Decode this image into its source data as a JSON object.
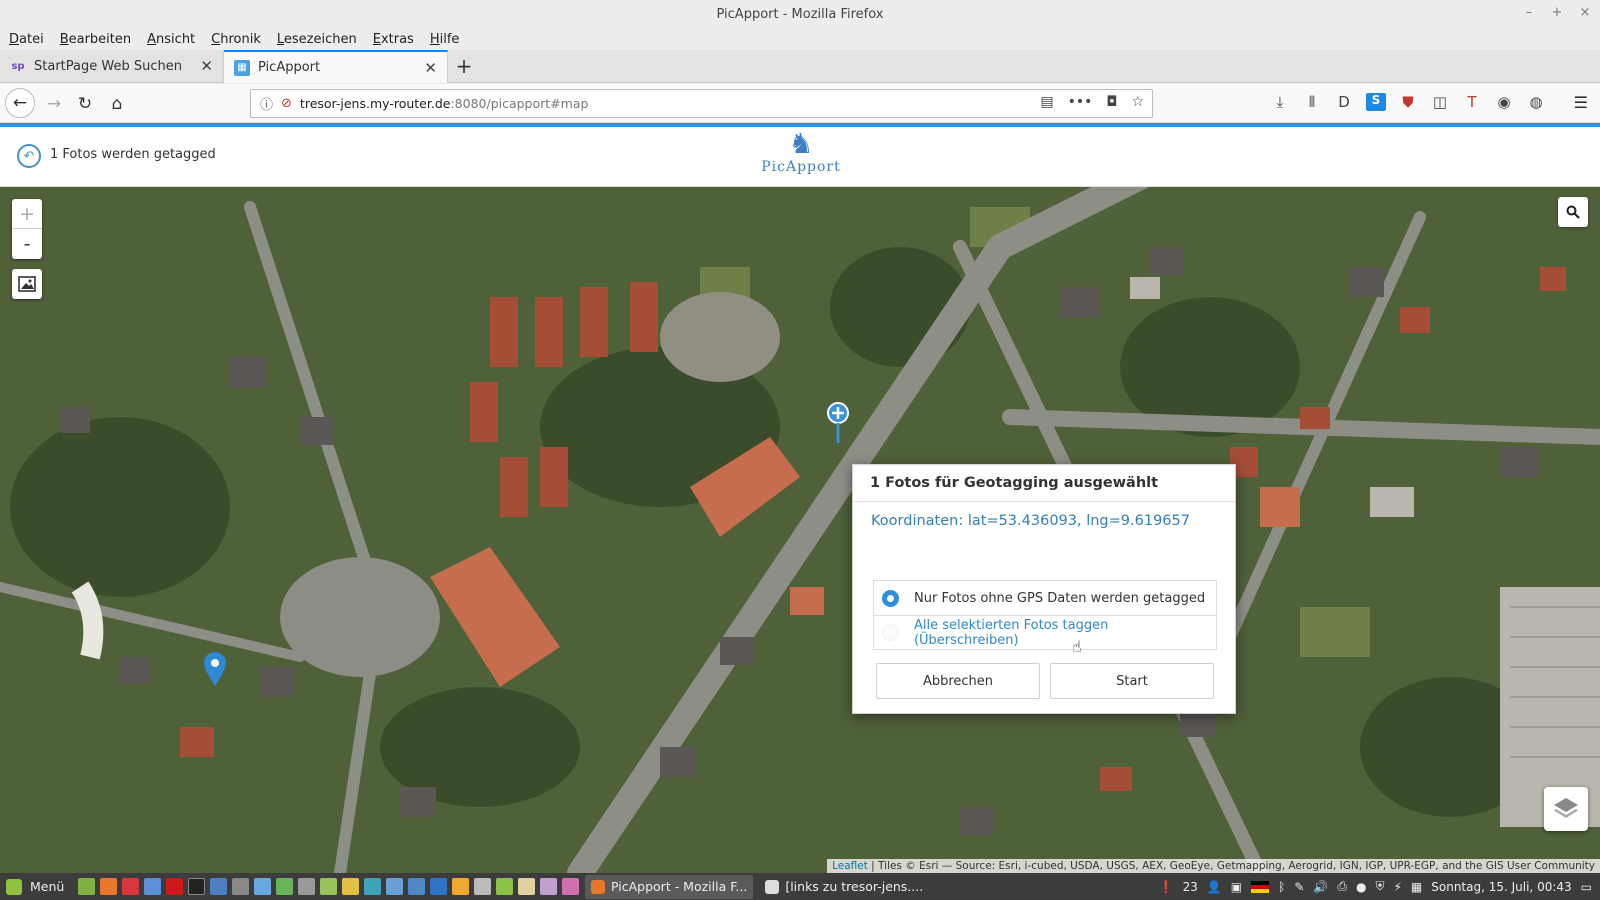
{
  "window": {
    "title": "PicApport - Mozilla Firefox",
    "controls": {
      "minimize": "–",
      "maximize": "+",
      "close": "×"
    }
  },
  "menubar": [
    "Datei",
    "Bearbeiten",
    "Ansicht",
    "Chronik",
    "Lesezeichen",
    "Extras",
    "Hilfe"
  ],
  "tabs": [
    {
      "label": "StartPage Web Suchen",
      "favicon": "sp"
    },
    {
      "label": "PicApport",
      "favicon": "picapport",
      "active": true
    }
  ],
  "navbar": {
    "url_host": "tresor-jens.my-router.de",
    "url_rest": ":8080/picapport#map",
    "icons": [
      "back-icon",
      "forward-icon",
      "reload-icon",
      "home-icon",
      "info-icon",
      "insecure-icon",
      "reader-mode-icon",
      "page-actions-icon",
      "pocket-icon",
      "bookmark-star-icon",
      "downloads-icon",
      "library-icon",
      "extension-d-icon",
      "extension-s-icon",
      "ublock-icon",
      "sidebar-icon",
      "extension-t-icon",
      "extension-a-icon",
      "extension-b-icon",
      "hamburger-menu-icon"
    ]
  },
  "app": {
    "tag_status": "1 Fotos werden getagged",
    "logo_text": "PicApport"
  },
  "map": {
    "zoom_in": "+",
    "zoom_out": "-",
    "attribution_link": "Leaflet",
    "attribution_text": " | Tiles © Esri — Source: Esri, i-cubed, USDA, USGS, AEX, GeoEye, Getmapping, Aerogrid, IGN, IGP, UPR-EGP, and the GIS User Community"
  },
  "dialog": {
    "title": "1 Fotos für Geotagging ausgewählt",
    "coordinates": "Koordinaten: lat=53.436093, lng=9.619657",
    "options": [
      {
        "label": "Nur Fotos ohne GPS Daten werden getagged",
        "selected": true
      },
      {
        "label": "Alle selektierten Fotos taggen (Überschreiben)",
        "selected": false
      }
    ],
    "cancel_label": "Abbrechen",
    "start_label": "Start"
  },
  "taskbar": {
    "menu_label": "Menü",
    "tasks": [
      {
        "label": "PicApport - Mozilla F...",
        "active": true
      },
      {
        "label": "[links zu tresor-jens....",
        "active": false
      }
    ],
    "tray_count": "23",
    "clock": "Sonntag, 15. Juli, 00:43"
  },
  "colors": {
    "accent": "#2f8fd9",
    "link": "#2e7fc0",
    "firefox_blue": "#0a84ff",
    "taskbar": "#3c3c3c"
  }
}
